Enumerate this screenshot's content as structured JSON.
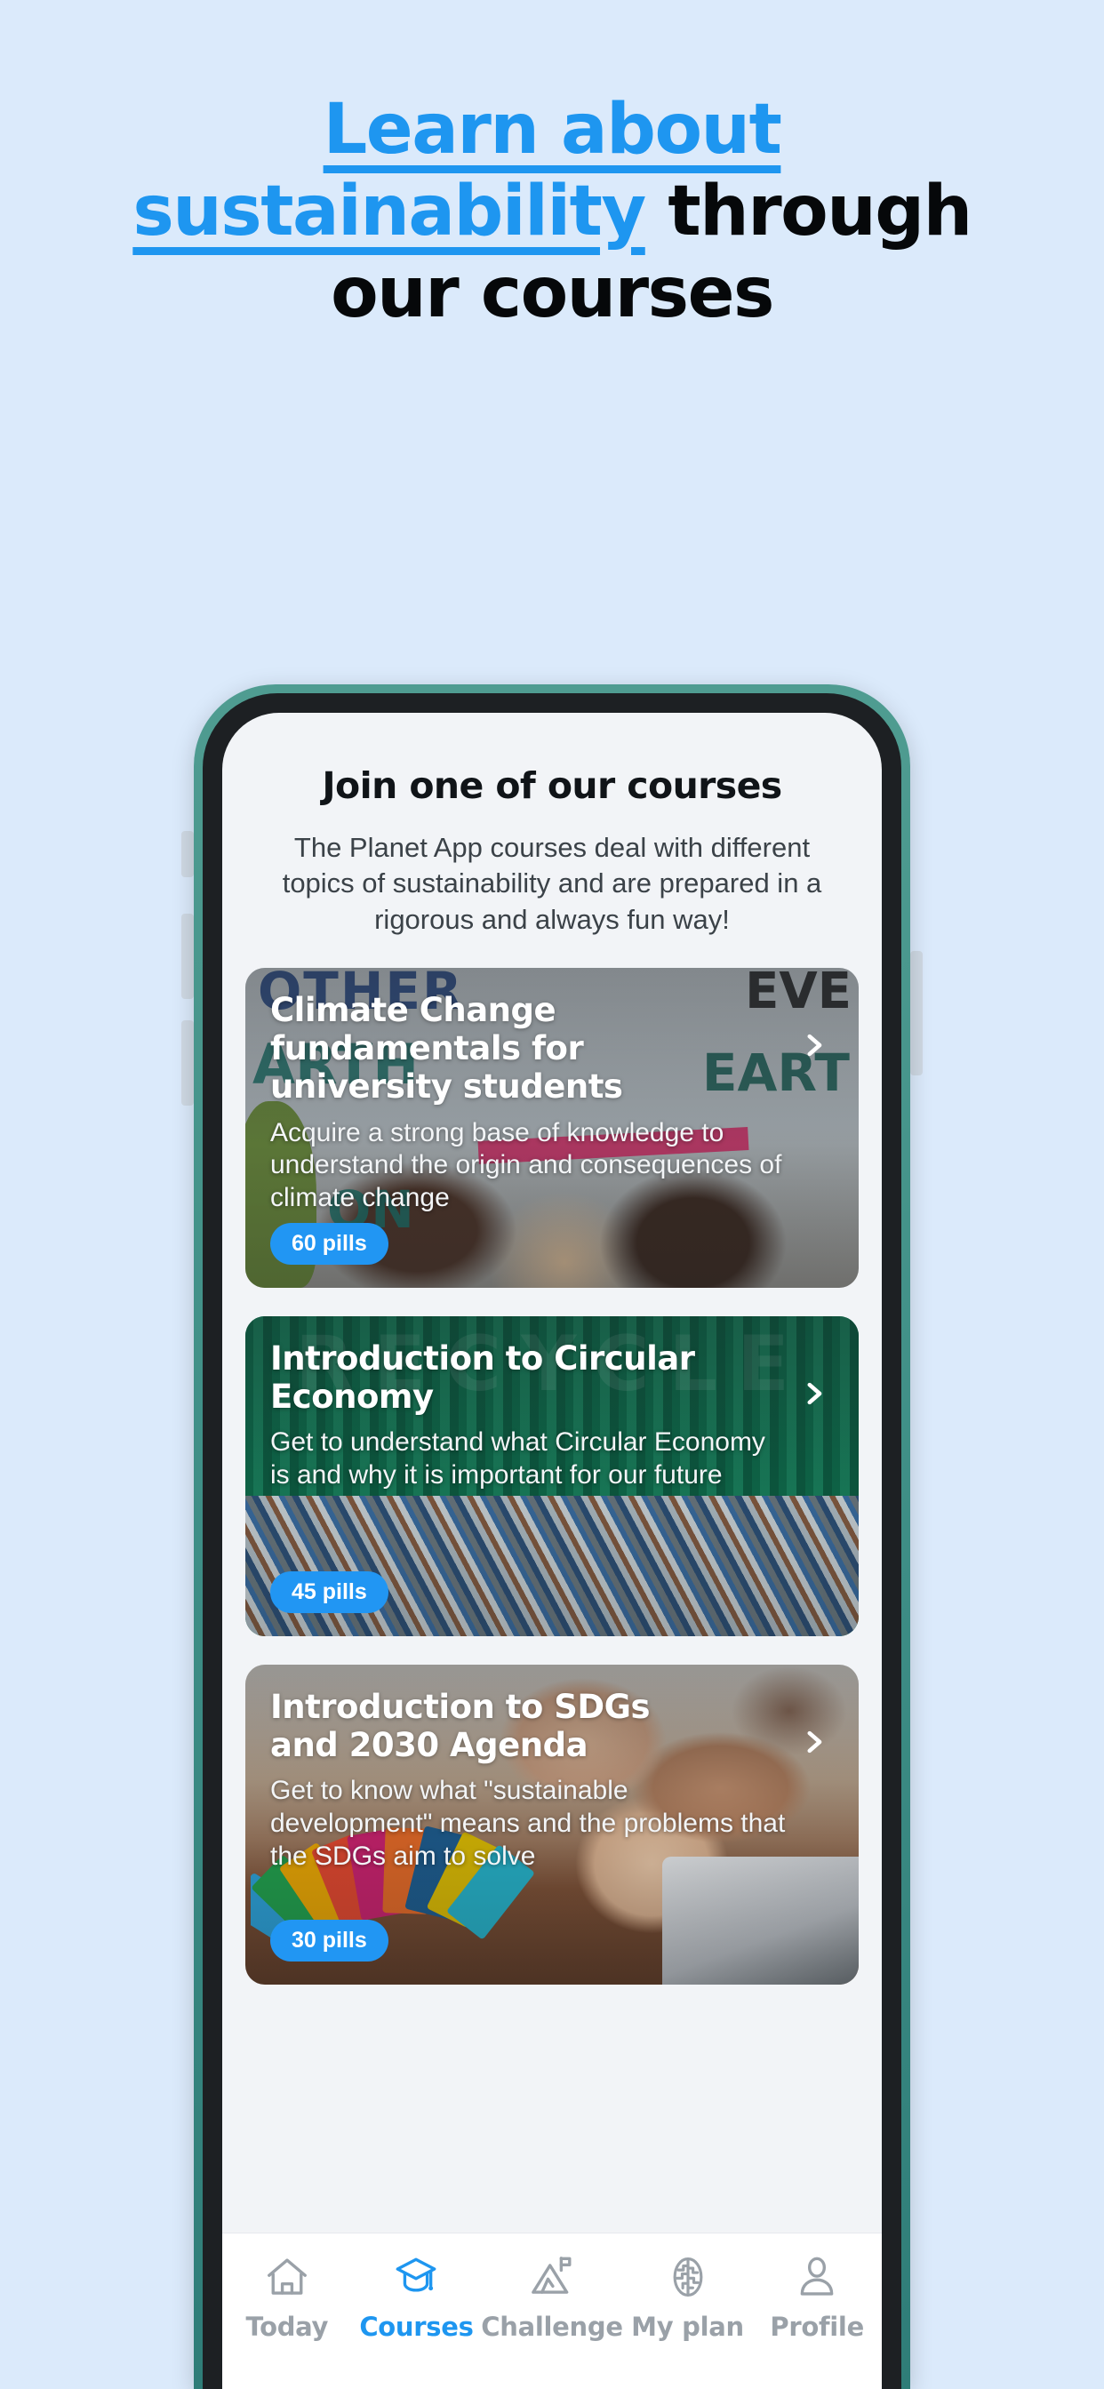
{
  "hero": {
    "line1_highlight": "Learn about",
    "line2_highlight": "sustainability",
    "line2_rest": " through",
    "line3": "our courses",
    "highlight_color": "#1e96f0",
    "text_color": "#06080a",
    "page_background": "#dbeafb"
  },
  "phone": {
    "frame_color": "#3e8e86",
    "bezel_color": "#1d2023",
    "screen_background": "#f2f4f7"
  },
  "screen": {
    "title": "Join one of our courses",
    "description": "The Planet App courses deal with different topics of sustainability and are prepared in a rigorous and always fun way!",
    "courses": [
      {
        "title": "Climate Change fundamentals for university students",
        "description": "Acquire a strong base of knowledge to understand the origin and consequences of climate change",
        "badge": "60 pills",
        "chevron": "chevron-right-icon",
        "sign_words": [
          "OTHER",
          "EVE",
          "ARTH",
          "EART",
          "ON"
        ]
      },
      {
        "title": "Introduction to Circular Economy",
        "description": "Get to understand what Circular Economy is and why it is important for our future",
        "badge": "45 pills",
        "chevron": "chevron-right-icon",
        "watermark": "RECYCLE"
      },
      {
        "title": "Introduction to SDGs and 2030 Agenda",
        "description": "Get to know what \"sustainable development\" means and the problems that the SDGs aim to solve",
        "badge": "30 pills",
        "chevron": "chevron-right-icon"
      }
    ],
    "badge_color": "#2196f3"
  },
  "tabbar": {
    "active_color": "#1e96f0",
    "inactive_color": "#9aa1a8",
    "items": [
      {
        "label": "Today",
        "icon": "home-icon",
        "active": false
      },
      {
        "label": "Courses",
        "icon": "graduation-cap-icon",
        "active": true
      },
      {
        "label": "Challenge",
        "icon": "mountain-flag-icon",
        "active": false
      },
      {
        "label": "My plan",
        "icon": "brain-icon",
        "active": false
      },
      {
        "label": "Profile",
        "icon": "person-icon",
        "active": false
      }
    ]
  }
}
